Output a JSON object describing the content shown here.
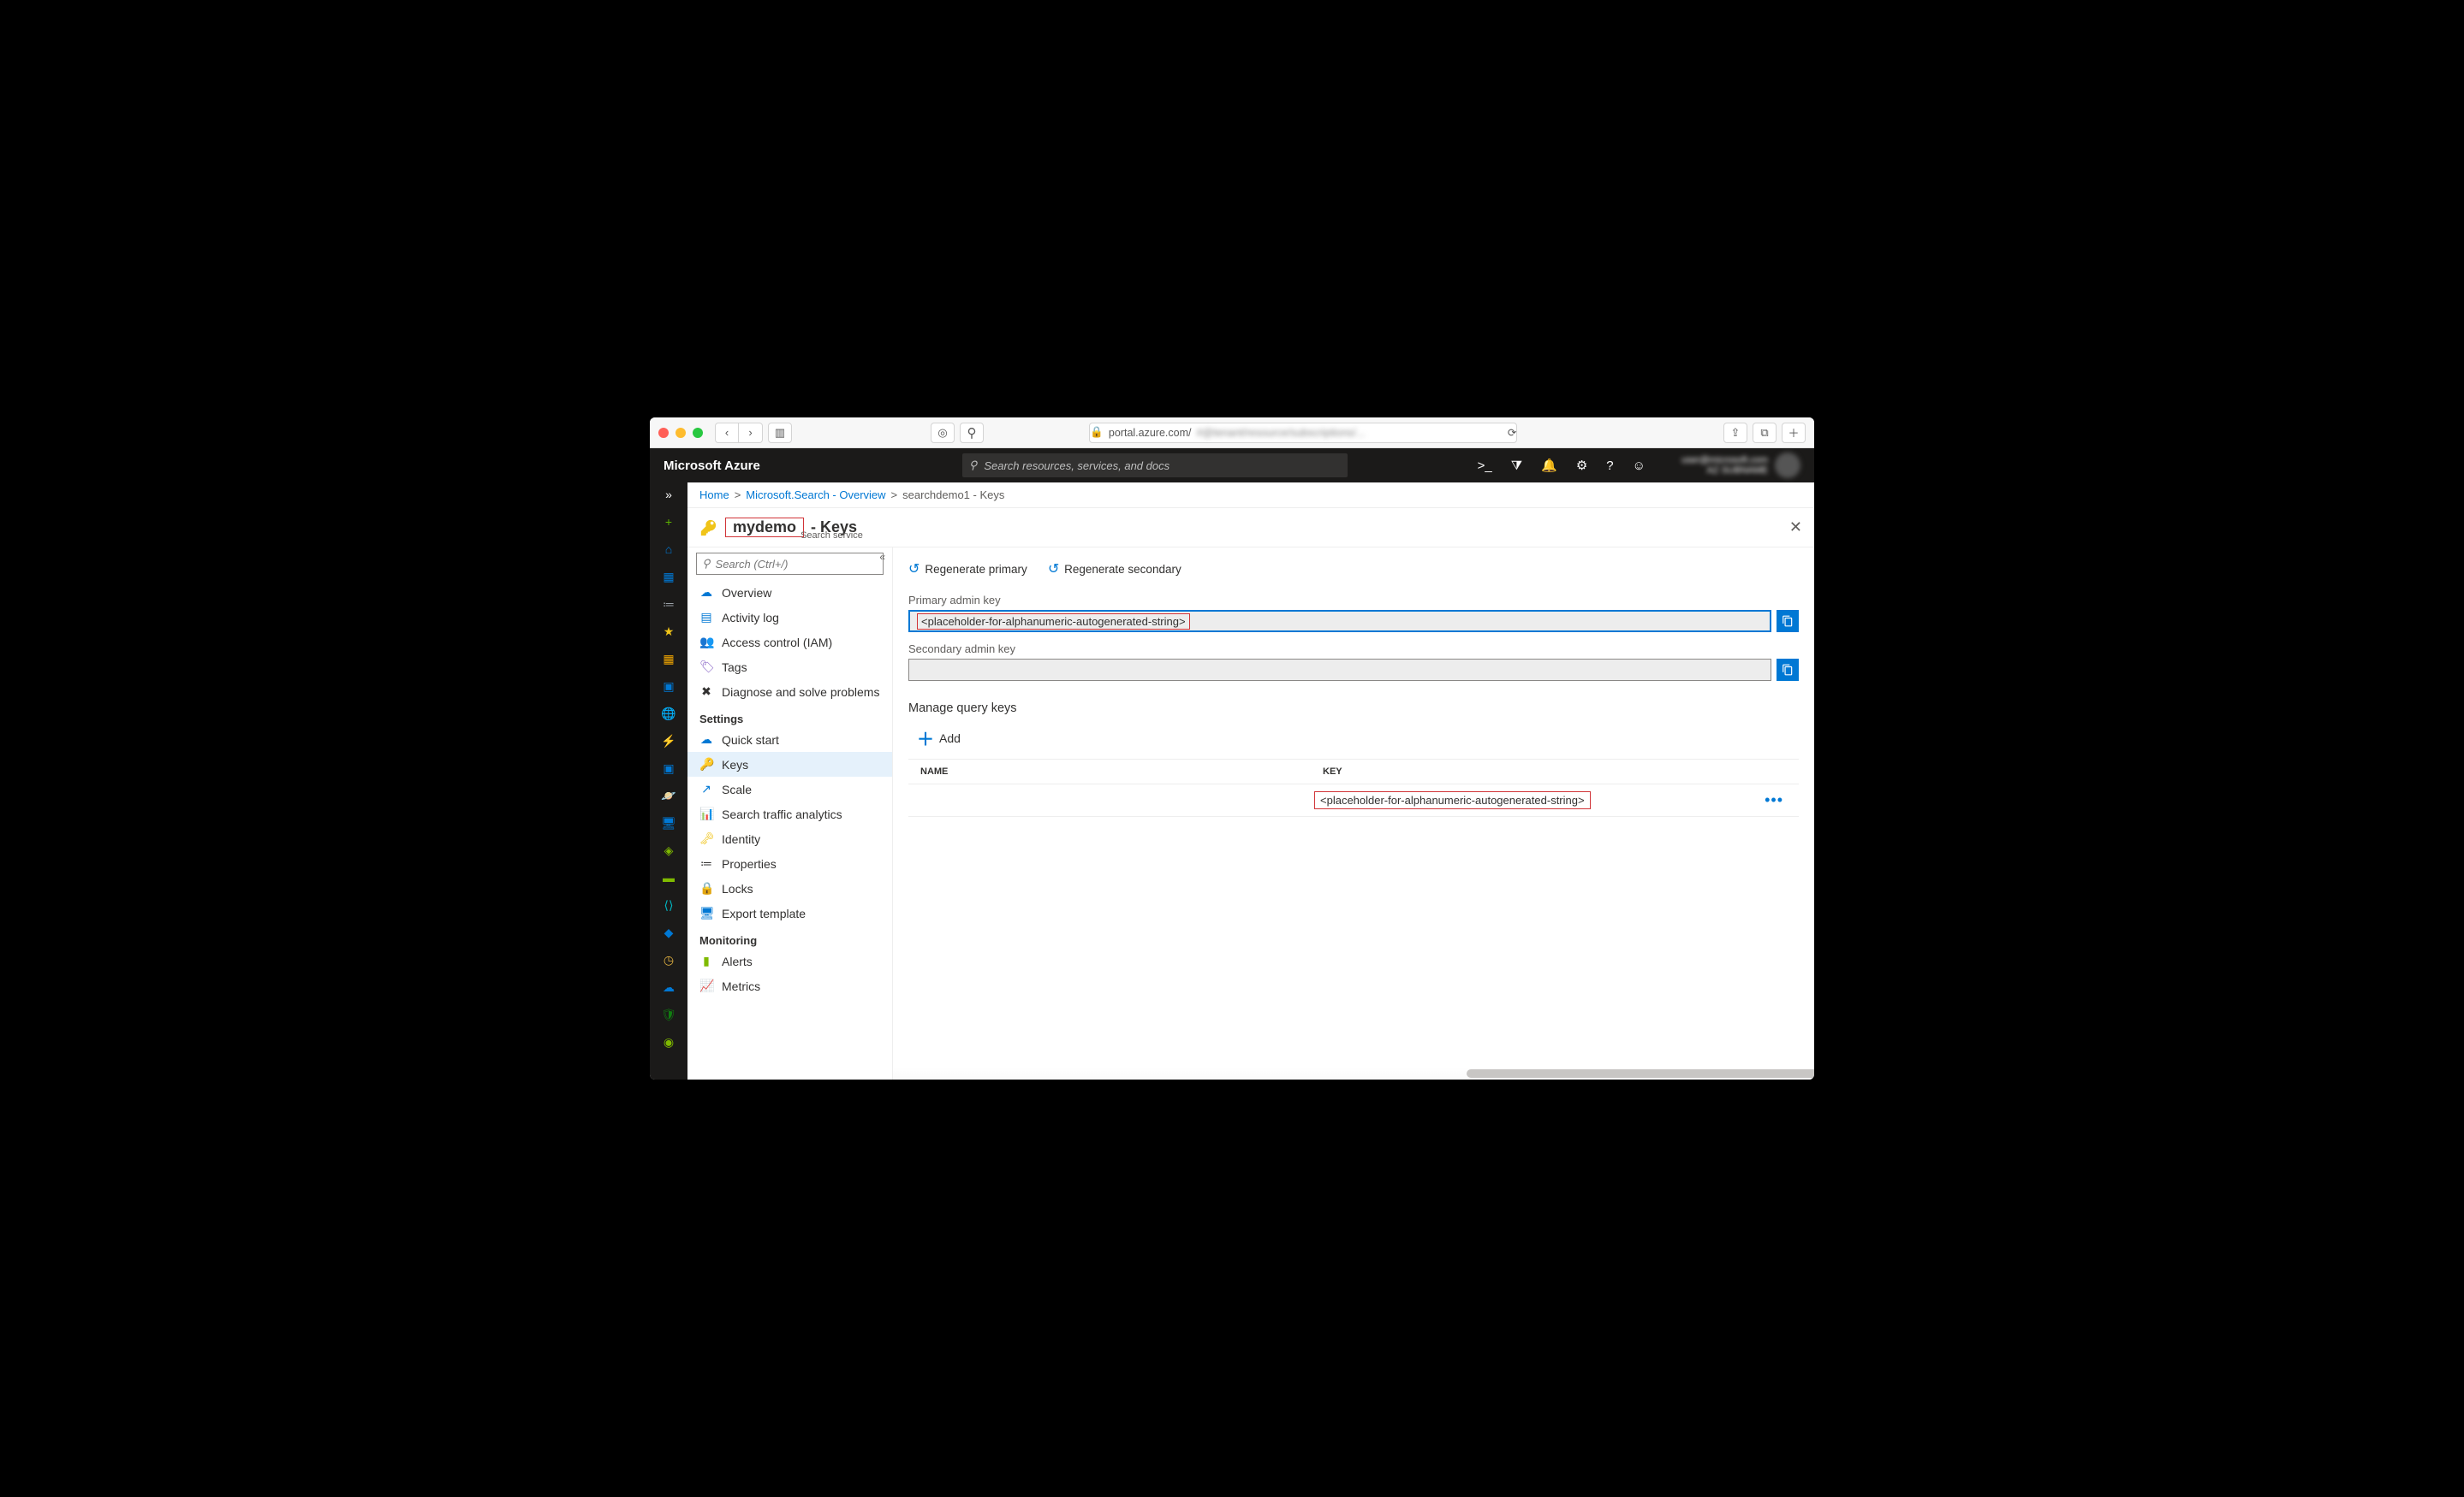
{
  "safari": {
    "url_host": "portal.azure.com/",
    "url_rest_blurred": "#@tenant/resource/subscriptions/..."
  },
  "topbar": {
    "brand": "Microsoft Azure",
    "search_placeholder": "Search resources, services, and docs",
    "user_email_blurred": "user@microsoft.com",
    "user_sub_blurred": "AZ SUBNAME"
  },
  "breadcrumb": {
    "home": "Home",
    "crumb1": "Microsoft.Search - Overview",
    "crumb2": "searchdemo1 - Keys"
  },
  "page": {
    "icon": "key-icon",
    "name": "mydemo",
    "suffix": "- Keys",
    "subtitle": "Search service"
  },
  "blade_nav": {
    "search_placeholder": "Search (Ctrl+/)",
    "items": [
      {
        "label": "Overview",
        "icon": "☁",
        "iconColor": "#0078d4"
      },
      {
        "label": "Activity log",
        "icon": "▤",
        "iconColor": "#0078d4"
      },
      {
        "label": "Access control (IAM)",
        "icon": "👥",
        "iconColor": "#0078d4"
      },
      {
        "label": "Tags",
        "icon": "🏷",
        "iconColor": "#8661c5"
      },
      {
        "label": "Diagnose and solve problems",
        "icon": "✖",
        "iconColor": "#323130"
      }
    ],
    "section_settings": "Settings",
    "settings_items": [
      {
        "label": "Quick start",
        "icon": "☁",
        "iconColor": "#0078d4"
      },
      {
        "label": "Keys",
        "icon": "🔑",
        "iconColor": "#f0c419",
        "selected": true
      },
      {
        "label": "Scale",
        "icon": "↗",
        "iconColor": "#0078d4"
      },
      {
        "label": "Search traffic analytics",
        "icon": "📊",
        "iconColor": "#0078d4"
      },
      {
        "label": "Identity",
        "icon": "🗝",
        "iconColor": "#f0c419"
      },
      {
        "label": "Properties",
        "icon": "≔",
        "iconColor": "#323130"
      },
      {
        "label": "Locks",
        "icon": "🔒",
        "iconColor": "#323130"
      },
      {
        "label": "Export template",
        "icon": "🖥",
        "iconColor": "#0078d4"
      }
    ],
    "section_monitoring": "Monitoring",
    "monitoring_items": [
      {
        "label": "Alerts",
        "icon": "▮",
        "iconColor": "#7fba00"
      },
      {
        "label": "Metrics",
        "icon": "📈",
        "iconColor": "#0078d4"
      }
    ]
  },
  "blade": {
    "regen_primary": "Regenerate primary",
    "regen_secondary": "Regenerate secondary",
    "primary_label": "Primary admin key",
    "primary_value": "<placeholder-for-alphanumeric-autogenerated-string>",
    "secondary_label": "Secondary admin key",
    "secondary_value": "",
    "manage_query_keys": "Manage query keys",
    "add_label": "Add",
    "table": {
      "col_name": "NAME",
      "col_key": "KEY",
      "rows": [
        {
          "name": "",
          "key": "<placeholder-for-alphanumeric-autogenerated-string>"
        }
      ]
    }
  },
  "rail": {
    "items": [
      {
        "name": "create-resource",
        "glyph": "+",
        "color": "#5db300"
      },
      {
        "name": "home",
        "glyph": "⌂",
        "color": "#0078d4"
      },
      {
        "name": "dashboard",
        "glyph": "▦",
        "color": "#0078d4"
      },
      {
        "name": "all-services",
        "glyph": "≔",
        "color": "#9aa0a6"
      },
      {
        "name": "favorites",
        "glyph": "★",
        "color": "#f0c419"
      },
      {
        "name": "all-resources",
        "glyph": "▦",
        "color": "#f0a500"
      },
      {
        "name": "resource-groups",
        "glyph": "▣",
        "color": "#0078d4"
      },
      {
        "name": "web",
        "glyph": "🌐",
        "color": "#0078d4"
      },
      {
        "name": "functions",
        "glyph": "⚡",
        "color": "#f0c419"
      },
      {
        "name": "sql",
        "glyph": "▣",
        "color": "#0078d4"
      },
      {
        "name": "cosmos",
        "glyph": "🪐",
        "color": "#8661c5"
      },
      {
        "name": "vms",
        "glyph": "🖥",
        "color": "#0078d4"
      },
      {
        "name": "load-balancers",
        "glyph": "◈",
        "color": "#7fba00"
      },
      {
        "name": "storage",
        "glyph": "▬",
        "color": "#7fba00"
      },
      {
        "name": "networking",
        "glyph": "⟨⟩",
        "color": "#00b7c3"
      },
      {
        "name": "azure-ad",
        "glyph": "◆",
        "color": "#0078d4"
      },
      {
        "name": "monitor",
        "glyph": "◷",
        "color": "#e3b341"
      },
      {
        "name": "advisor",
        "glyph": "☁",
        "color": "#0078d4"
      },
      {
        "name": "security",
        "glyph": "🛡",
        "color": "#107c10"
      },
      {
        "name": "cost",
        "glyph": "◉",
        "color": "#7fba00"
      }
    ]
  }
}
